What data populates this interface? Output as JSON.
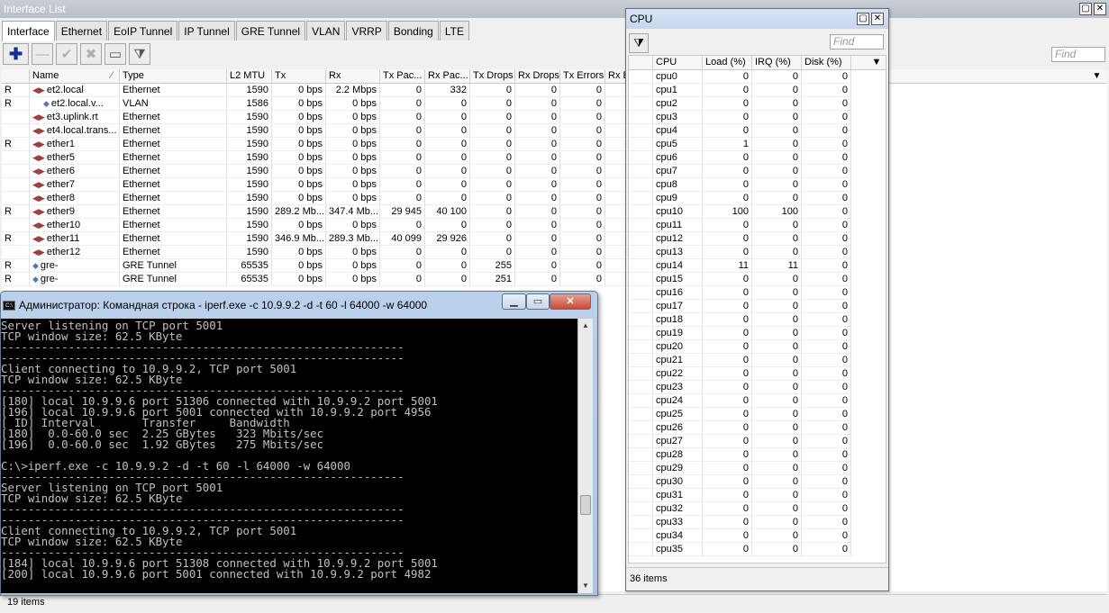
{
  "interface_window": {
    "title": "Interface List",
    "tabs": [
      "Interface",
      "Ethernet",
      "EoIP Tunnel",
      "IP Tunnel",
      "GRE Tunnel",
      "VLAN",
      "VRRP",
      "Bonding",
      "LTE"
    ],
    "find_placeholder": "Find",
    "columns": [
      "",
      "Name",
      "Type",
      "L2 MTU",
      "Tx",
      "Rx",
      "Tx Pac...",
      "Rx Pac...",
      "Tx Drops",
      "Rx Drops",
      "Tx Errors",
      "Rx E"
    ],
    "rows": [
      {
        "flag": "R",
        "name": "et2.local",
        "type": "Ethernet",
        "mtu": "1590",
        "tx": "0 bps",
        "rx": "2.2 Mbps",
        "txp": "0",
        "rxp": "332",
        "txd": "0",
        "rxd": "0",
        "txe": "0"
      },
      {
        "flag": "R",
        "name": "et2.local.v...",
        "type": "VLAN",
        "mtu": "1586",
        "tx": "0 bps",
        "rx": "0 bps",
        "txp": "0",
        "rxp": "0",
        "txd": "0",
        "rxd": "0",
        "txe": "0"
      },
      {
        "flag": "",
        "name": "et3.uplink.rt",
        "type": "Ethernet",
        "mtu": "1590",
        "tx": "0 bps",
        "rx": "0 bps",
        "txp": "0",
        "rxp": "0",
        "txd": "0",
        "rxd": "0",
        "txe": "0"
      },
      {
        "flag": "",
        "name": "et4.local.trans...",
        "type": "Ethernet",
        "mtu": "1590",
        "tx": "0 bps",
        "rx": "0 bps",
        "txp": "0",
        "rxp": "0",
        "txd": "0",
        "rxd": "0",
        "txe": "0"
      },
      {
        "flag": "R",
        "name": "ether1",
        "type": "Ethernet",
        "mtu": "1590",
        "tx": "0 bps",
        "rx": "0 bps",
        "txp": "0",
        "rxp": "0",
        "txd": "0",
        "rxd": "0",
        "txe": "0"
      },
      {
        "flag": "",
        "name": "ether5",
        "type": "Ethernet",
        "mtu": "1590",
        "tx": "0 bps",
        "rx": "0 bps",
        "txp": "0",
        "rxp": "0",
        "txd": "0",
        "rxd": "0",
        "txe": "0"
      },
      {
        "flag": "",
        "name": "ether6",
        "type": "Ethernet",
        "mtu": "1590",
        "tx": "0 bps",
        "rx": "0 bps",
        "txp": "0",
        "rxp": "0",
        "txd": "0",
        "rxd": "0",
        "txe": "0"
      },
      {
        "flag": "",
        "name": "ether7",
        "type": "Ethernet",
        "mtu": "1590",
        "tx": "0 bps",
        "rx": "0 bps",
        "txp": "0",
        "rxp": "0",
        "txd": "0",
        "rxd": "0",
        "txe": "0"
      },
      {
        "flag": "",
        "name": "ether8",
        "type": "Ethernet",
        "mtu": "1590",
        "tx": "0 bps",
        "rx": "0 bps",
        "txp": "0",
        "rxp": "0",
        "txd": "0",
        "rxd": "0",
        "txe": "0"
      },
      {
        "flag": "R",
        "name": "ether9",
        "type": "Ethernet",
        "mtu": "1590",
        "tx": "289.2 Mb...",
        "rx": "347.4 Mb...",
        "txp": "29 945",
        "rxp": "40 100",
        "txd": "0",
        "rxd": "0",
        "txe": "0"
      },
      {
        "flag": "",
        "name": "ether10",
        "type": "Ethernet",
        "mtu": "1590",
        "tx": "0 bps",
        "rx": "0 bps",
        "txp": "0",
        "rxp": "0",
        "txd": "0",
        "rxd": "0",
        "txe": "0"
      },
      {
        "flag": "R",
        "name": "ether11",
        "type": "Ethernet",
        "mtu": "1590",
        "tx": "346.9 Mb...",
        "rx": "289.3 Mb...",
        "txp": "40 099",
        "rxp": "29 926",
        "txd": "0",
        "rxd": "0",
        "txe": "0"
      },
      {
        "flag": "",
        "name": "ether12",
        "type": "Ethernet",
        "mtu": "1590",
        "tx": "0 bps",
        "rx": "0 bps",
        "txp": "0",
        "rxp": "0",
        "txd": "0",
        "rxd": "0",
        "txe": "0"
      },
      {
        "flag": "R",
        "name": "gre-",
        "type": "GRE Tunnel",
        "mtu": "65535",
        "tx": "0 bps",
        "rx": "0 bps",
        "txp": "0",
        "rxp": "0",
        "txd": "255",
        "rxd": "0",
        "txe": "0"
      },
      {
        "flag": "R",
        "name": "gre-",
        "type": "GRE Tunnel",
        "mtu": "65535",
        "tx": "0 bps",
        "rx": "0 bps",
        "txp": "0",
        "rxp": "0",
        "txd": "251",
        "rxd": "0",
        "txe": "0"
      }
    ],
    "status": "19 items"
  },
  "cpu_window": {
    "title": "CPU",
    "find_placeholder": "Find",
    "columns": [
      "CPU",
      "Load (%)",
      "IRQ (%)",
      "Disk (%)"
    ],
    "rows": [
      [
        "cpu0",
        "0",
        "0",
        "0"
      ],
      [
        "cpu1",
        "0",
        "0",
        "0"
      ],
      [
        "cpu2",
        "0",
        "0",
        "0"
      ],
      [
        "cpu3",
        "0",
        "0",
        "0"
      ],
      [
        "cpu4",
        "0",
        "0",
        "0"
      ],
      [
        "cpu5",
        "1",
        "0",
        "0"
      ],
      [
        "cpu6",
        "0",
        "0",
        "0"
      ],
      [
        "cpu7",
        "0",
        "0",
        "0"
      ],
      [
        "cpu8",
        "0",
        "0",
        "0"
      ],
      [
        "cpu9",
        "0",
        "0",
        "0"
      ],
      [
        "cpu10",
        "100",
        "100",
        "0"
      ],
      [
        "cpu11",
        "0",
        "0",
        "0"
      ],
      [
        "cpu12",
        "0",
        "0",
        "0"
      ],
      [
        "cpu13",
        "0",
        "0",
        "0"
      ],
      [
        "cpu14",
        "11",
        "11",
        "0"
      ],
      [
        "cpu15",
        "0",
        "0",
        "0"
      ],
      [
        "cpu16",
        "0",
        "0",
        "0"
      ],
      [
        "cpu17",
        "0",
        "0",
        "0"
      ],
      [
        "cpu18",
        "0",
        "0",
        "0"
      ],
      [
        "cpu19",
        "0",
        "0",
        "0"
      ],
      [
        "cpu20",
        "0",
        "0",
        "0"
      ],
      [
        "cpu21",
        "0",
        "0",
        "0"
      ],
      [
        "cpu22",
        "0",
        "0",
        "0"
      ],
      [
        "cpu23",
        "0",
        "0",
        "0"
      ],
      [
        "cpu24",
        "0",
        "0",
        "0"
      ],
      [
        "cpu25",
        "0",
        "0",
        "0"
      ],
      [
        "cpu26",
        "0",
        "0",
        "0"
      ],
      [
        "cpu27",
        "0",
        "0",
        "0"
      ],
      [
        "cpu28",
        "0",
        "0",
        "0"
      ],
      [
        "cpu29",
        "0",
        "0",
        "0"
      ],
      [
        "cpu30",
        "0",
        "0",
        "0"
      ],
      [
        "cpu31",
        "0",
        "0",
        "0"
      ],
      [
        "cpu32",
        "0",
        "0",
        "0"
      ],
      [
        "cpu33",
        "0",
        "0",
        "0"
      ],
      [
        "cpu34",
        "0",
        "0",
        "0"
      ],
      [
        "cpu35",
        "0",
        "0",
        "0"
      ]
    ],
    "status": "36 items"
  },
  "console_window": {
    "icon_text": "C:\\",
    "title": "Администратор: Командная строка - iperf.exe  -c 10.9.9.2 -d -t 60 -l 64000 -w 64000",
    "lines": [
      "Server listening on TCP port 5001",
      "TCP window size: 62.5 KByte",
      "------------------------------------------------------------",
      "------------------------------------------------------------",
      "Client connecting to 10.9.9.2, TCP port 5001",
      "TCP window size: 62.5 KByte",
      "------------------------------------------------------------",
      "[180] local 10.9.9.6 port 51306 connected with 10.9.9.2 port 5001",
      "[196] local 10.9.9.6 port 5001 connected with 10.9.9.2 port 4956",
      "[ ID] Interval       Transfer     Bandwidth",
      "[180]  0.0-60.0 sec  2.25 GBytes   323 Mbits/sec",
      "[196]  0.0-60.0 sec  1.92 GBytes   275 Mbits/sec",
      "",
      "C:\\>iperf.exe -c 10.9.9.2 -d -t 60 -l 64000 -w 64000",
      "------------------------------------------------------------",
      "Server listening on TCP port 5001",
      "TCP window size: 62.5 KByte",
      "------------------------------------------------------------",
      "------------------------------------------------------------",
      "Client connecting to 10.9.9.2, TCP port 5001",
      "TCP window size: 62.5 KByte",
      "------------------------------------------------------------",
      "[184] local 10.9.9.6 port 51308 connected with 10.9.9.2 port 5001",
      "[200] local 10.9.9.6 port 5001 connected with 10.9.9.2 port 4982"
    ]
  },
  "icons": {
    "iface_ethernet": "◀▶",
    "iface_tunnel": "◆",
    "add": "✚",
    "remove": "—",
    "enable": "✔",
    "disable": "✖",
    "comment": "▭",
    "filter": "⧩",
    "maximize": "▢",
    "close": "✕",
    "minimize": "▁",
    "restore": "▭",
    "scroll_up": "▲",
    "scroll_down": "▼",
    "sort": "⁄",
    "menu": "▼"
  },
  "colors": {
    "iface_titlebar": "#bcc1c9",
    "cpu_titlebar": "#c9dbf1",
    "console_bg": "#000000",
    "console_text": "#c0c0c0"
  }
}
